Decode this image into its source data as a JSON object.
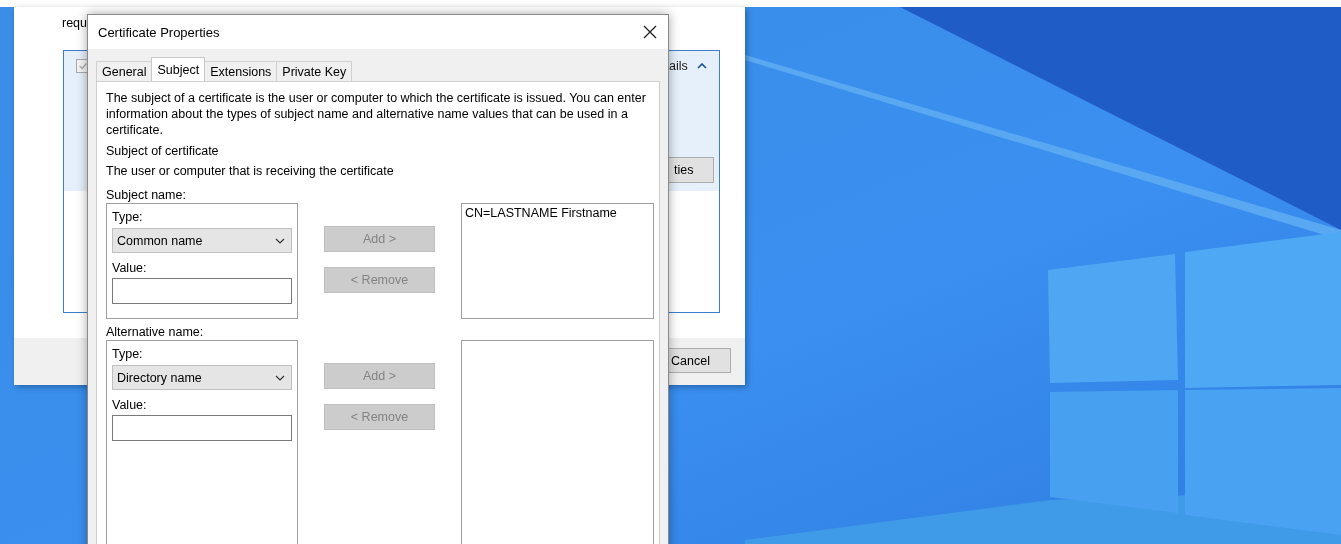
{
  "background_window": {
    "intro_fragment": "requ",
    "checkbox": {
      "checked": true,
      "disabled": true
    },
    "details_link": "ails",
    "properties_button": "ties",
    "cancel_button": "Cancel"
  },
  "dialog": {
    "title": "Certificate Properties",
    "tabs": [
      {
        "label": "General",
        "selected": false
      },
      {
        "label": "Subject",
        "selected": true
      },
      {
        "label": "Extensions",
        "selected": false
      },
      {
        "label": "Private Key",
        "selected": false
      }
    ],
    "description": "The subject of a certificate is the user or computer to which the certificate is issued. You can enter information about the types of subject name and alternative name values that can be used in a certificate.",
    "section_title": "Subject of certificate",
    "section_subtitle": "The user or computer that is receiving the certificate",
    "groups": [
      {
        "label": "Subject name:",
        "type_label": "Type:",
        "type_value": "Common name",
        "value_label": "Value:",
        "add_button": {
          "label": "Add >",
          "disabled": true
        },
        "remove_button": {
          "label": "< Remove",
          "disabled": true
        },
        "entries": [
          "CN=LASTNAME Firstname"
        ]
      },
      {
        "label": "Alternative name:",
        "type_label": "Type:",
        "type_value": "Directory name",
        "value_label": "Value:",
        "add_button": {
          "label": "Add >",
          "disabled": true
        },
        "remove_button": {
          "label": "< Remove",
          "disabled": true
        }
      }
    ]
  }
}
